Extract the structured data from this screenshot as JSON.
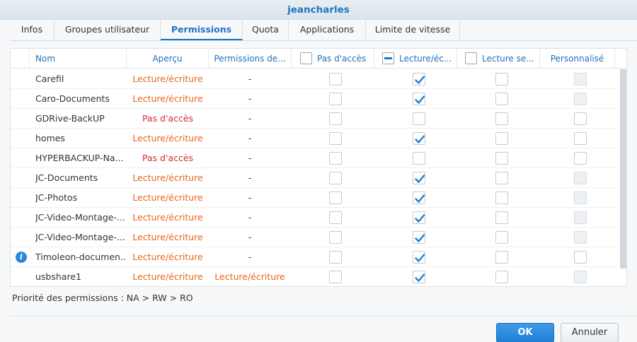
{
  "window": {
    "title": "jeancharles"
  },
  "tabs": [
    {
      "label": "Infos",
      "active": false
    },
    {
      "label": "Groupes utilisateur",
      "active": false
    },
    {
      "label": "Permissions",
      "active": true
    },
    {
      "label": "Quota",
      "active": false
    },
    {
      "label": "Applications",
      "active": false
    },
    {
      "label": "Limite de vitesse",
      "active": false
    }
  ],
  "table": {
    "columns": {
      "nom": "Nom",
      "apercu": "Aperçu",
      "permissions_de": "Permissions de...",
      "pas_acces": "Pas d'accès",
      "lecture_ecriture": "Lecture/éc...",
      "lecture_seule": "Lecture se...",
      "personnalise": "Personnalisé"
    },
    "header_checks": {
      "pas_acces": "unchecked",
      "lecture_ecriture": "partial",
      "lecture_seule": "unchecked"
    },
    "rows": [
      {
        "name": "Carefil",
        "apercu": "Lecture/écriture",
        "apercu_type": "rw",
        "permissions_de": "-",
        "na": false,
        "rw": true,
        "ro": false,
        "custom_disabled": true,
        "info": false
      },
      {
        "name": "Caro-Documents",
        "apercu": "Lecture/écriture",
        "apercu_type": "rw",
        "permissions_de": "-",
        "na": false,
        "rw": true,
        "ro": false,
        "custom_disabled": true,
        "info": false
      },
      {
        "name": "GDRive-BackUP",
        "apercu": "Pas d'accès",
        "apercu_type": "na",
        "permissions_de": "-",
        "na": false,
        "rw": false,
        "ro": false,
        "custom_disabled": false,
        "info": false
      },
      {
        "name": "homes",
        "apercu": "Lecture/écriture",
        "apercu_type": "rw",
        "permissions_de": "-",
        "na": false,
        "rw": true,
        "ro": false,
        "custom_disabled": false,
        "info": false
      },
      {
        "name": "HYPERBACKUP-Na...",
        "apercu": "Pas d'accès",
        "apercu_type": "na",
        "permissions_de": "-",
        "na": false,
        "rw": false,
        "ro": false,
        "custom_disabled": false,
        "info": false
      },
      {
        "name": "JC-Documents",
        "apercu": "Lecture/écriture",
        "apercu_type": "rw",
        "permissions_de": "-",
        "na": false,
        "rw": true,
        "ro": false,
        "custom_disabled": true,
        "info": false
      },
      {
        "name": "JC-Photos",
        "apercu": "Lecture/écriture",
        "apercu_type": "rw",
        "permissions_de": "-",
        "na": false,
        "rw": true,
        "ro": false,
        "custom_disabled": true,
        "info": false
      },
      {
        "name": "JC-Video-Montage-...",
        "apercu": "Lecture/écriture",
        "apercu_type": "rw",
        "permissions_de": "-",
        "na": false,
        "rw": true,
        "ro": false,
        "custom_disabled": true,
        "info": false
      },
      {
        "name": "JC-Video-Montage-...",
        "apercu": "Lecture/écriture",
        "apercu_type": "rw",
        "permissions_de": "-",
        "na": false,
        "rw": true,
        "ro": false,
        "custom_disabled": true,
        "info": false
      },
      {
        "name": "Timoleon-documen...",
        "apercu": "Lecture/écriture",
        "apercu_type": "rw",
        "permissions_de": "-",
        "na": false,
        "rw": true,
        "ro": false,
        "custom_disabled": false,
        "info": true
      },
      {
        "name": "usbshare1",
        "apercu": "Lecture/écriture",
        "apercu_type": "rw",
        "permissions_de": "Lecture/écriture",
        "permissions_de_type": "rw",
        "na": false,
        "rw": true,
        "ro": false,
        "custom_disabled": true,
        "info": false
      }
    ]
  },
  "footer": {
    "priority_text": "Priorité des permissions : NA > RW > RO"
  },
  "buttons": {
    "ok": "OK",
    "cancel": "Annuler"
  },
  "colors": {
    "accent": "#1f75c4",
    "rw": "#e8641b",
    "na": "#d0312d"
  }
}
